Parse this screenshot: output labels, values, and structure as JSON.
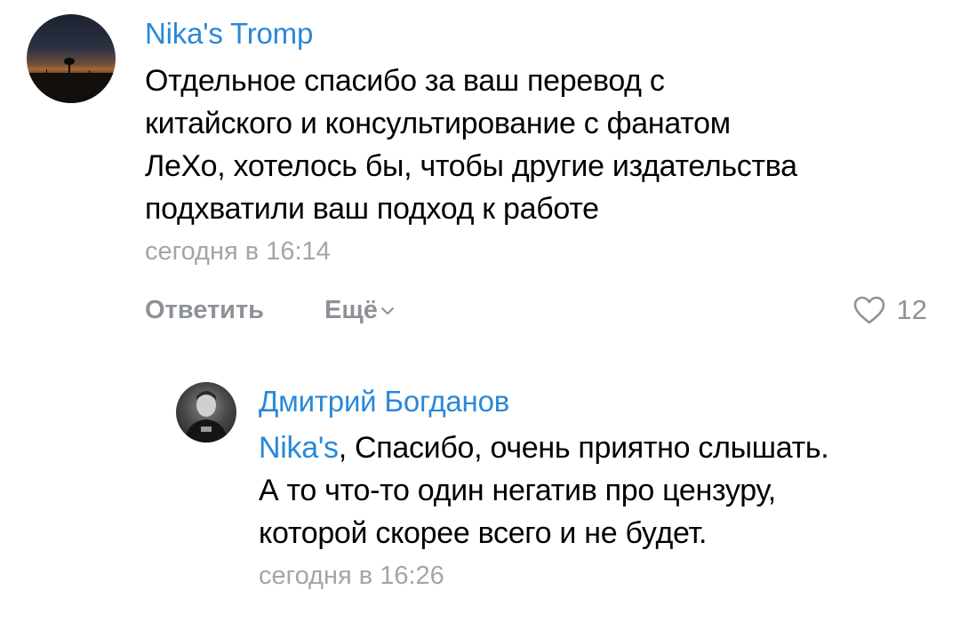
{
  "comments": [
    {
      "author": "Nika's Tromp",
      "text_lines": [
        "Отдельное спасибо за ваш перевод с",
        "китайского и консультирование с фанатом",
        "ЛеХо, хотелось бы, чтобы другие издательства",
        "подхватили ваш подход к работе"
      ],
      "time": "сегодня в 16:14",
      "actions": {
        "reply_label": "Ответить",
        "more_label": "Ещё",
        "like_count": "12"
      },
      "avatar_icon": "sunset-landscape-avatar"
    },
    {
      "author": "Дмитрий Богданов",
      "mention": "Nika's",
      "text_first_line_rest": ", Спасибо, очень приятно слышать.",
      "text_lines_rest": [
        "А то что-то один негатив про цензуру,",
        "которой скорее всего и не будет."
      ],
      "time": "сегодня в 16:26",
      "avatar_icon": "person-photo-avatar"
    }
  ],
  "icons": {
    "like": "heart-outline-icon",
    "more": "chevron-down-icon"
  },
  "colors": {
    "link": "#2a88d8",
    "meta": "#a2a5aa",
    "action": "#8e9297"
  }
}
